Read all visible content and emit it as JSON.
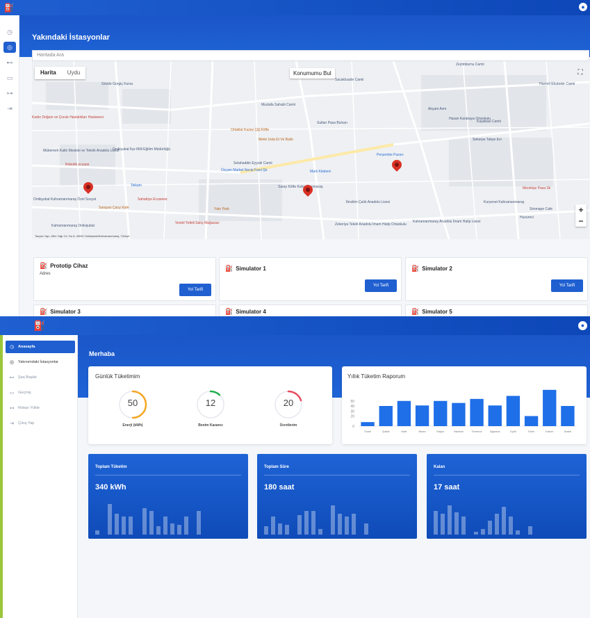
{
  "colors": {
    "primary": "#1f5fd0",
    "header": "#1b56c8",
    "accent_green": "#9bc63a",
    "pin": "#d93025"
  },
  "screen1": {
    "rail_icons": [
      "clock-icon",
      "location-icon",
      "plug-icon",
      "calendar-icon",
      "route-icon",
      "logout-icon"
    ],
    "page_title": "Yakındaki İstasyonlar",
    "map_search_placeholder": "Haritada Ara",
    "map": {
      "type_map": "Harita",
      "type_sat": "Uydu",
      "locate_label": "Konumumu Bul",
      "footer": "Tacyan Yapı, Mim Yağı Cd. No 8, 46000 Onikişubat/Kahramanmaraş, Türkiye",
      "places": [
        "Gözde Gürgiç Kursu",
        "Zeytinburnu Camii",
        "Mustafa Sahabi Camii",
        "Sacaklızade Camii",
        "Akçam Avm",
        "Kadın Doğum ve Çocuk Hastalıkları Hastanesi",
        "Ortaklar Kuzey Çiğ Köfte",
        "Metin Usta Et Ve Balık",
        "Sultan Pasa Bulvarı",
        "Sekerpe Tabye Evi",
        "Onikişubat İlçe Milli Eğitim Müdürlüğü",
        "Mükerrem Katin Mesleki ve Teknik Anadolu Lisesi",
        "Robotik eczane",
        "Selahaddin Eyyubi Camii",
        "Özçam Market Necip Fazıl Şb",
        "Mark Kitabevi",
        "Perşembe Pazarı",
        "Telkam",
        "Sahabiye Eczanesi",
        "Saray Köfte Kahramanmaraş",
        "İbrahim Çalık Anadolu Lisesi",
        "Sarayan Çarşı Kafe",
        "Yatır Park",
        "Vestel Yetkili Satış Mağazası",
        "Zekeriya Tekeli Anadolu İmam Hatip Ortaokulu",
        "Kahramanmaraş Anadolu İmam Hatip Lisesi",
        "Kuryenet Kahramanmaraş",
        "Simmape Cafe",
        "Huzurevi",
        "Merekişe Pasa Sk",
        "Kahramanmaraş Onikişubat",
        "Onikişubat Kahramanmaraş Özel Sosyal",
        "Hazreti Ebubekir Camii",
        "Hasan Karakaya Ortaokulu",
        "Kayabasi Camii"
      ]
    },
    "devices": [
      {
        "name": "Prototip Cihaz",
        "address": "Adres",
        "route": "Yol Tarifi"
      },
      {
        "name": "Simulator 1",
        "address": "",
        "route": "Yol Tarifi"
      },
      {
        "name": "Simulator 2",
        "address": "",
        "route": "Yol Tarifi"
      },
      {
        "name": "Simulator 3"
      },
      {
        "name": "Simulator 4"
      },
      {
        "name": "Simulator 5"
      }
    ]
  },
  "screen2": {
    "sidebar": [
      {
        "label": "Anasayfa",
        "icon": "clock-icon"
      },
      {
        "label": "Yakınımdaki İstasyonlar",
        "icon": "location-icon"
      },
      {
        "label": "Şarj Başlat",
        "icon": "plug-icon"
      },
      {
        "label": "Geçmiş",
        "icon": "calendar-icon"
      },
      {
        "label": "Rotayı Yükle",
        "icon": "route-icon"
      },
      {
        "label": "Çıkış Yap",
        "icon": "logout-icon"
      }
    ],
    "greeting": "Merhaba",
    "daily": {
      "title": "Günlük Tüketimim",
      "gauges": [
        {
          "value": "50",
          "label": "Enerji (kWh)",
          "fraction": 0.5,
          "color": "#f5a623"
        },
        {
          "value": "12",
          "label": "Benim Kazancı",
          "fraction": 0.12,
          "color": "#1fae4b"
        },
        {
          "value": "20",
          "label": "Ücretlerim",
          "fraction": 0.2,
          "color": "#e94b5f"
        }
      ]
    },
    "yearly": {
      "title": "Yıllık Tüketim Raporum"
    },
    "stats": [
      {
        "title": "Toplam Tüketim",
        "value": "340 kWh"
      },
      {
        "title": "Toplam Süre",
        "value": "180 saat"
      },
      {
        "title": "Kalan",
        "value": "17 saat"
      }
    ]
  },
  "chart_data": {
    "type": "bar",
    "categories": [
      "Ocak",
      "Şubat",
      "Mart",
      "Nisan",
      "Mayıs",
      "Haziran",
      "Temmuz",
      "Ağustos",
      "Eylül",
      "Ekim",
      "Kasım",
      "Aralık"
    ],
    "values": [
      8,
      40,
      50,
      41,
      50,
      46,
      54,
      41,
      60,
      20,
      72,
      40
    ],
    "yticks": [
      0,
      20,
      30,
      40,
      50
    ],
    "ylim": [
      0,
      80
    ],
    "title": "Yıllık Tüketim Raporum",
    "xlabel": "",
    "ylabel": "",
    "color": "#1f6fe8"
  }
}
